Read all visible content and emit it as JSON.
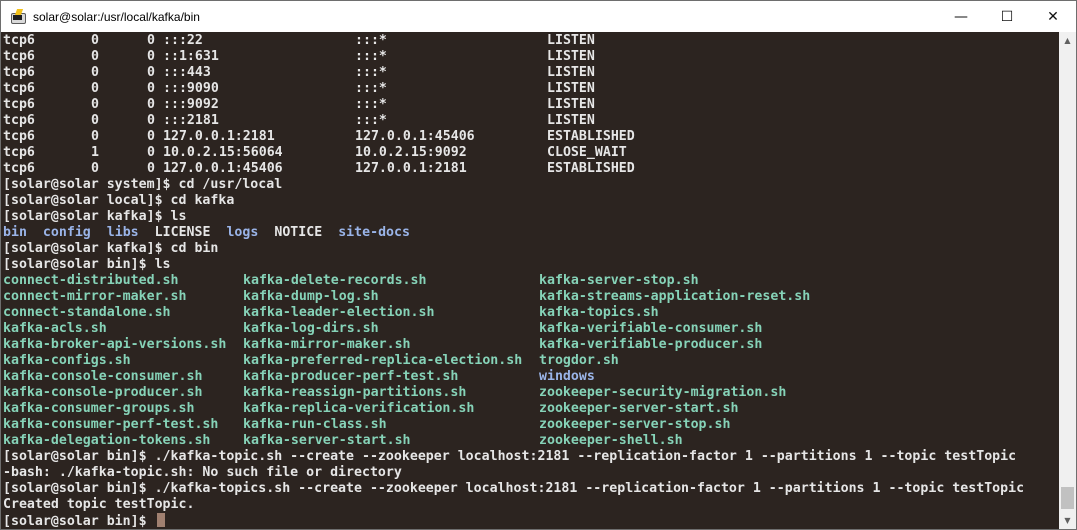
{
  "window": {
    "title": "solar@solar:/usr/local/kafka/bin",
    "minimize_label": "—",
    "maximize_label": "☐",
    "close_label": "✕"
  },
  "netstat_rows": [
    {
      "proto": "tcp6",
      "recvq": "0",
      "sendq": "0",
      "local": ":::22",
      "foreign": ":::*",
      "state": "LISTEN"
    },
    {
      "proto": "tcp6",
      "recvq": "0",
      "sendq": "0",
      "local": "::1:631",
      "foreign": ":::*",
      "state": "LISTEN"
    },
    {
      "proto": "tcp6",
      "recvq": "0",
      "sendq": "0",
      "local": ":::443",
      "foreign": ":::*",
      "state": "LISTEN"
    },
    {
      "proto": "tcp6",
      "recvq": "0",
      "sendq": "0",
      "local": ":::9090",
      "foreign": ":::*",
      "state": "LISTEN"
    },
    {
      "proto": "tcp6",
      "recvq": "0",
      "sendq": "0",
      "local": ":::9092",
      "foreign": ":::*",
      "state": "LISTEN"
    },
    {
      "proto": "tcp6",
      "recvq": "0",
      "sendq": "0",
      "local": ":::2181",
      "foreign": ":::*",
      "state": "LISTEN"
    },
    {
      "proto": "tcp6",
      "recvq": "0",
      "sendq": "0",
      "local": "127.0.0.1:2181",
      "foreign": "127.0.0.1:45406",
      "state": "ESTABLISHED"
    },
    {
      "proto": "tcp6",
      "recvq": "1",
      "sendq": "0",
      "local": "10.0.2.15:56064",
      "foreign": "10.0.2.15:9092",
      "state": "CLOSE_WAIT"
    },
    {
      "proto": "tcp6",
      "recvq": "0",
      "sendq": "0",
      "local": "127.0.0.1:45406",
      "foreign": "127.0.0.1:2181",
      "state": "ESTABLISHED"
    }
  ],
  "commands": {
    "cd_local": "[solar@solar system]$ cd /usr/local",
    "cd_kafka": "[solar@solar local]$ cd kafka",
    "ls_kafka": "[solar@solar kafka]$ ls",
    "cd_bin": "[solar@solar kafka]$ cd bin",
    "ls_bin": "[solar@solar bin]$ ls",
    "create_typo": "[solar@solar bin]$ ./kafka-topic.sh --create --zookeeper localhost:2181 --replication-factor 1 --partitions 1 --topic testTopic",
    "bash_error": "-bash: ./kafka-topic.sh: No such file or directory",
    "create_ok": "[solar@solar bin]$ ./kafka-topics.sh --create --zookeeper localhost:2181 --replication-factor 1 --partitions 1 --topic testTopic",
    "created_msg": "Created topic testTopic.",
    "prompt": "[solar@solar bin]$ "
  },
  "kafka_dir_listing": [
    {
      "name": "bin",
      "kind": "dir"
    },
    {
      "name": "config",
      "kind": "dir"
    },
    {
      "name": "libs",
      "kind": "dir"
    },
    {
      "name": "LICENSE",
      "kind": "file"
    },
    {
      "name": "logs",
      "kind": "dir"
    },
    {
      "name": "NOTICE",
      "kind": "file"
    },
    {
      "name": "site-docs",
      "kind": "dir"
    }
  ],
  "bin_listing": [
    [
      "connect-distributed.sh",
      "kafka-delete-records.sh",
      "kafka-server-stop.sh"
    ],
    [
      "connect-mirror-maker.sh",
      "kafka-dump-log.sh",
      "kafka-streams-application-reset.sh"
    ],
    [
      "connect-standalone.sh",
      "kafka-leader-election.sh",
      "kafka-topics.sh"
    ],
    [
      "kafka-acls.sh",
      "kafka-log-dirs.sh",
      "kafka-verifiable-consumer.sh"
    ],
    [
      "kafka-broker-api-versions.sh",
      "kafka-mirror-maker.sh",
      "kafka-verifiable-producer.sh"
    ],
    [
      "kafka-configs.sh",
      "kafka-preferred-replica-election.sh",
      "trogdor.sh"
    ],
    [
      "kafka-console-consumer.sh",
      "kafka-producer-perf-test.sh",
      "windows"
    ],
    [
      "kafka-console-producer.sh",
      "kafka-reassign-partitions.sh",
      "zookeeper-security-migration.sh"
    ],
    [
      "kafka-consumer-groups.sh",
      "kafka-replica-verification.sh",
      "zookeeper-server-start.sh"
    ],
    [
      "kafka-consumer-perf-test.sh",
      "kafka-run-class.sh",
      "zookeeper-server-stop.sh"
    ],
    [
      "kafka-delegation-tokens.sh",
      "kafka-server-start.sh",
      "zookeeper-shell.sh"
    ]
  ],
  "bin_dir_entries": [
    "windows"
  ],
  "colors": {
    "terminal_bg": "#2c2420",
    "text": "#e6e6e6",
    "dir": "#9ab4e8",
    "executable": "#86d3b8"
  }
}
